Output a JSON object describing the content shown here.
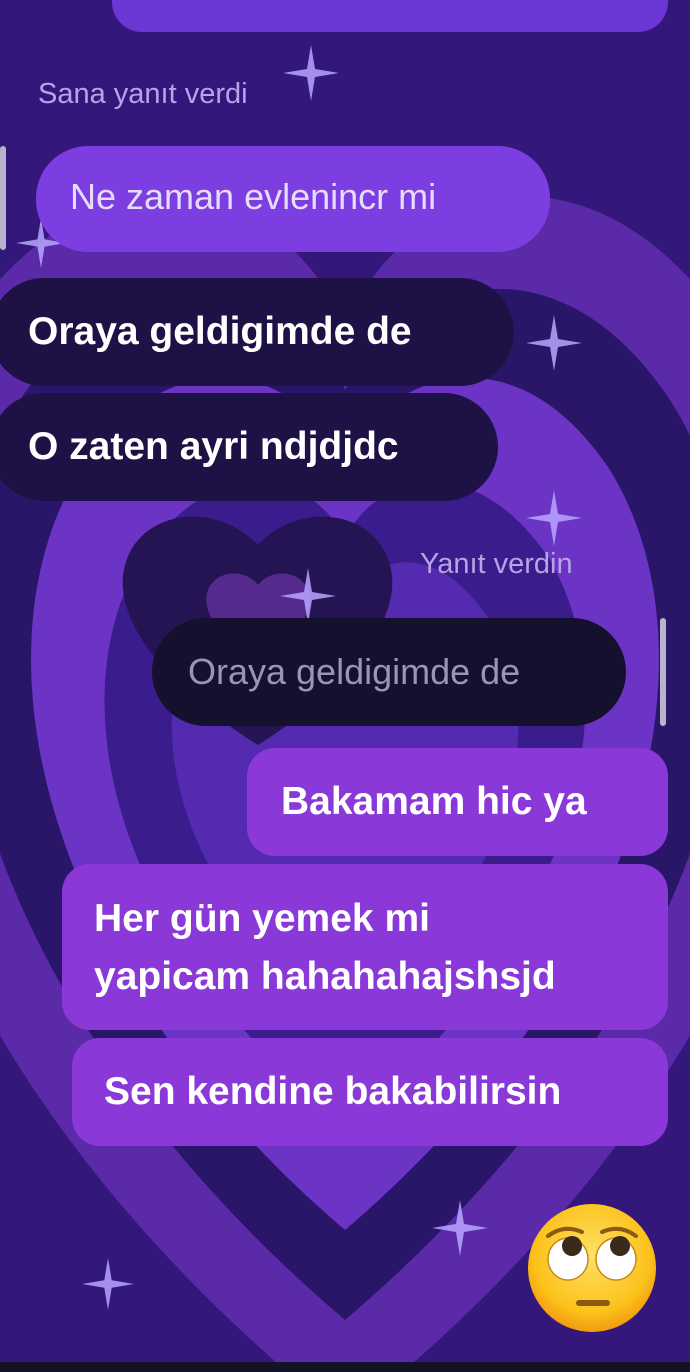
{
  "chat": {
    "reply_label_incoming": "Sana yanıt verdi",
    "quoted_incoming": "Ne zaman evlenincr mi",
    "incoming_messages": [
      "Oraya geldigimde de",
      "O zaten ayri ndjdjdc"
    ],
    "reply_label_outgoing": "Yanıt verdin",
    "quoted_outgoing": "Oraya geldigimde de",
    "outgoing_messages": [
      "Bakamam hic ya",
      [
        "Her gün yemek mi",
        "yapicam hahahahajshsjd"
      ],
      "Sen kendine bakabilirsin"
    ],
    "sticker": "face-with-rolling-eyes"
  },
  "theme": {
    "background": "#3a1c86",
    "incoming_bubble": "#1d1145",
    "outgoing_bubble": "#8a38d8",
    "quoted_bubble": "#7c3ee0"
  }
}
